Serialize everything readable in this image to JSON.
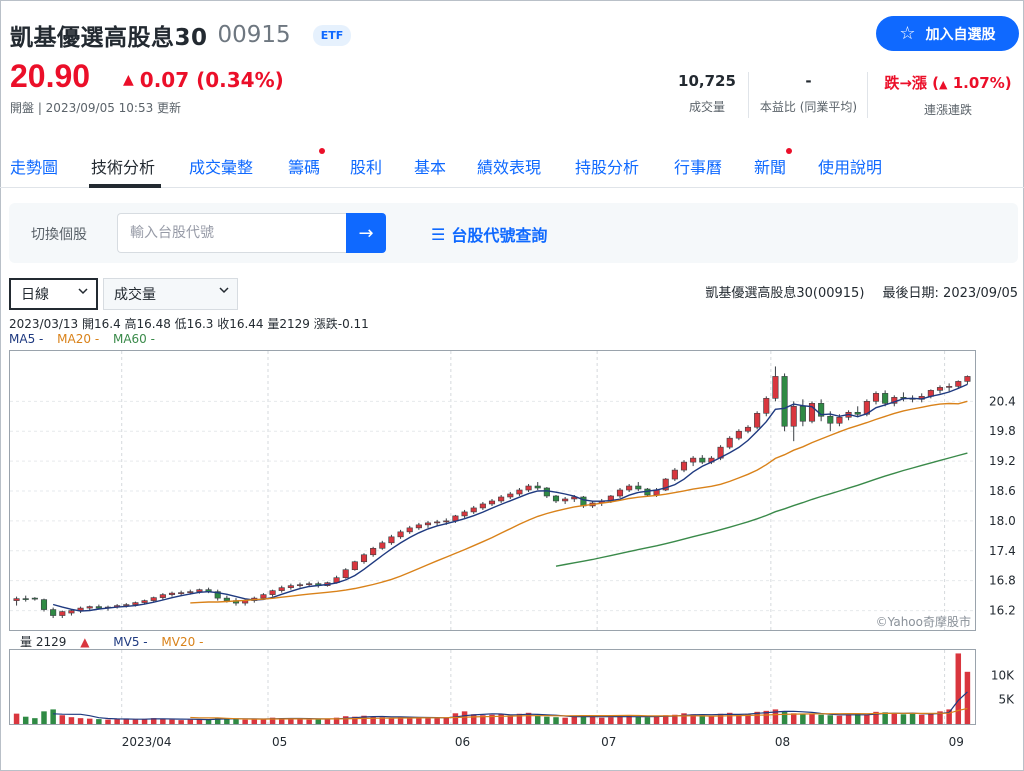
{
  "header": {
    "name": "凱基優選高股息30",
    "code": "00915",
    "badge": "ETF",
    "follow_label": "加入自選股",
    "price": "20.90",
    "change": "0.07 (0.34%)",
    "status": "開盤 | 2023/09/05 10:53 更新",
    "stats": [
      {
        "value": "10,725",
        "label": "成交量"
      },
      {
        "value": "-",
        "label": "本益比 (同業平均)"
      },
      {
        "value_prefix": "跌→漲 (",
        "value_main": "1.07%",
        "value_suffix": ")",
        "label": "連漲連跌"
      }
    ]
  },
  "tabs": [
    "走勢圖",
    "技術分析",
    "成交彙整",
    "籌碼",
    "股利",
    "基本",
    "績效表現",
    "持股分析",
    "行事曆",
    "新聞",
    "使用說明"
  ],
  "active_tab": "技術分析",
  "search": {
    "label": "切換個股",
    "placeholder": "輸入台股代號",
    "lookup_label": "台股代號查詢"
  },
  "controls": {
    "period": "日線",
    "indicator": "成交量",
    "chart_title": "凱基優選高股息30(00915)",
    "last_date": "最後日期: 2023/09/05"
  },
  "ohlc_line": "2023/03/13 開16.4 高16.48 低16.3 收16.44 量2129 漲跌-0.11",
  "ma_legend": [
    {
      "label": "MA5 -",
      "color": "#1f3a80"
    },
    {
      "label": "MA20 -",
      "color": "#d9821a"
    },
    {
      "label": "MA60 -",
      "color": "#3a8a4a"
    }
  ],
  "vol_legend": {
    "vol": "量 2129",
    "arrow": "▲",
    "mv5": "MV5 -",
    "mv20": "MV20 -"
  },
  "watermark": "©Yahoo奇摩股市",
  "colors": {
    "up": "#d9363e",
    "down": "#2f8a44",
    "accent": "#0f69ff",
    "ma5": "#1f3a80",
    "ma20": "#d9821a",
    "ma60": "#3a8a4a"
  },
  "chart_data": {
    "type": "candlestick",
    "price_ticks": [
      16.2,
      16.8,
      17.4,
      18.0,
      18.6,
      19.2,
      19.8,
      20.4
    ],
    "price_range": [
      15.85,
      21.35
    ],
    "volume_ticks": [
      "5K",
      "10K"
    ],
    "volume_range": [
      0,
      15000
    ],
    "x_labels": [
      {
        "label": "2023/04",
        "index": 12
      },
      {
        "label": "05",
        "index": 28
      },
      {
        "label": "06",
        "index": 48
      },
      {
        "label": "07",
        "index": 64
      },
      {
        "label": "08",
        "index": 83
      },
      {
        "label": "09",
        "index": 102
      }
    ],
    "count": 105,
    "candles": [
      [
        16.4,
        16.48,
        16.3,
        16.44
      ],
      [
        16.44,
        16.5,
        16.38,
        16.42
      ],
      [
        16.45,
        16.47,
        16.4,
        16.43
      ],
      [
        16.42,
        16.44,
        16.18,
        16.22
      ],
      [
        16.22,
        16.26,
        16.05,
        16.1
      ],
      [
        16.1,
        16.2,
        16.05,
        16.18
      ],
      [
        16.15,
        16.22,
        16.1,
        16.2
      ],
      [
        16.2,
        16.28,
        16.15,
        16.25
      ],
      [
        16.25,
        16.3,
        16.2,
        16.28
      ],
      [
        16.28,
        16.32,
        16.22,
        16.25
      ],
      [
        16.25,
        16.3,
        16.2,
        16.27
      ],
      [
        16.27,
        16.33,
        16.24,
        16.3
      ],
      [
        16.3,
        16.35,
        16.26,
        16.32
      ],
      [
        16.32,
        16.38,
        16.28,
        16.36
      ],
      [
        16.36,
        16.42,
        16.32,
        16.4
      ],
      [
        16.4,
        16.48,
        16.38,
        16.46
      ],
      [
        16.46,
        16.55,
        16.42,
        16.52
      ],
      [
        16.52,
        16.58,
        16.48,
        16.55
      ],
      [
        16.55,
        16.6,
        16.5,
        16.56
      ],
      [
        16.56,
        16.62,
        16.52,
        16.58
      ],
      [
        16.58,
        16.64,
        16.54,
        16.62
      ],
      [
        16.62,
        16.66,
        16.55,
        16.58
      ],
      [
        16.58,
        16.62,
        16.4,
        16.45
      ],
      [
        16.45,
        16.5,
        16.36,
        16.4
      ],
      [
        16.4,
        16.45,
        16.3,
        16.35
      ],
      [
        16.35,
        16.42,
        16.3,
        16.4
      ],
      [
        16.4,
        16.48,
        16.36,
        16.45
      ],
      [
        16.45,
        16.55,
        16.42,
        16.52
      ],
      [
        16.52,
        16.62,
        16.48,
        16.6
      ],
      [
        16.6,
        16.7,
        16.56,
        16.66
      ],
      [
        16.66,
        16.74,
        16.62,
        16.7
      ],
      [
        16.7,
        16.76,
        16.66,
        16.72
      ],
      [
        16.72,
        16.78,
        16.68,
        16.74
      ],
      [
        16.74,
        16.78,
        16.66,
        16.7
      ],
      [
        16.7,
        16.78,
        16.68,
        16.76
      ],
      [
        16.76,
        16.9,
        16.74,
        16.86
      ],
      [
        16.86,
        17.05,
        16.84,
        17.02
      ],
      [
        17.02,
        17.2,
        17.0,
        17.18
      ],
      [
        17.18,
        17.35,
        17.14,
        17.32
      ],
      [
        17.32,
        17.48,
        17.28,
        17.45
      ],
      [
        17.45,
        17.6,
        17.42,
        17.56
      ],
      [
        17.56,
        17.72,
        17.52,
        17.68
      ],
      [
        17.68,
        17.82,
        17.64,
        17.78
      ],
      [
        17.78,
        17.9,
        17.74,
        17.86
      ],
      [
        17.86,
        17.96,
        17.82,
        17.92
      ],
      [
        17.92,
        18.0,
        17.86,
        17.96
      ],
      [
        17.96,
        18.02,
        17.9,
        17.98
      ],
      [
        17.98,
        18.05,
        17.92,
        18.0
      ],
      [
        18.0,
        18.12,
        17.96,
        18.1
      ],
      [
        18.1,
        18.22,
        18.06,
        18.18
      ],
      [
        18.18,
        18.3,
        18.14,
        18.26
      ],
      [
        18.26,
        18.38,
        18.22,
        18.34
      ],
      [
        18.34,
        18.44,
        18.3,
        18.4
      ],
      [
        18.4,
        18.52,
        18.36,
        18.48
      ],
      [
        18.48,
        18.58,
        18.44,
        18.54
      ],
      [
        18.54,
        18.66,
        18.5,
        18.62
      ],
      [
        18.62,
        18.74,
        18.58,
        18.7
      ],
      [
        18.7,
        18.78,
        18.62,
        18.66
      ],
      [
        18.66,
        18.68,
        18.46,
        18.5
      ],
      [
        18.5,
        18.52,
        18.36,
        18.4
      ],
      [
        18.4,
        18.48,
        18.34,
        18.44
      ],
      [
        18.44,
        18.52,
        18.38,
        18.48
      ],
      [
        18.48,
        18.5,
        18.26,
        18.3
      ],
      [
        18.3,
        18.4,
        18.26,
        18.36
      ],
      [
        18.36,
        18.44,
        18.3,
        18.4
      ],
      [
        18.4,
        18.52,
        18.36,
        18.5
      ],
      [
        18.5,
        18.66,
        18.46,
        18.62
      ],
      [
        18.62,
        18.74,
        18.58,
        18.7
      ],
      [
        18.7,
        18.78,
        18.6,
        18.64
      ],
      [
        18.64,
        18.66,
        18.48,
        18.52
      ],
      [
        18.52,
        18.66,
        18.48,
        18.62
      ],
      [
        18.62,
        18.86,
        18.6,
        18.84
      ],
      [
        18.84,
        19.06,
        18.8,
        19.02
      ],
      [
        19.02,
        19.22,
        18.98,
        19.18
      ],
      [
        19.18,
        19.3,
        19.1,
        19.26
      ],
      [
        19.26,
        19.32,
        19.14,
        19.18
      ],
      [
        19.18,
        19.3,
        19.14,
        19.26
      ],
      [
        19.26,
        19.52,
        19.22,
        19.48
      ],
      [
        19.48,
        19.7,
        19.44,
        19.66
      ],
      [
        19.66,
        19.84,
        19.62,
        19.8
      ],
      [
        19.8,
        19.92,
        19.76,
        19.88
      ],
      [
        19.88,
        20.2,
        19.84,
        20.16
      ],
      [
        20.16,
        20.5,
        20.1,
        20.46
      ],
      [
        20.46,
        21.1,
        20.4,
        20.9
      ],
      [
        20.9,
        20.96,
        19.8,
        19.9
      ],
      [
        19.9,
        20.4,
        19.6,
        20.3
      ],
      [
        20.3,
        20.44,
        19.9,
        20.0
      ],
      [
        20.0,
        20.4,
        19.96,
        20.36
      ],
      [
        20.36,
        20.44,
        20.0,
        20.1
      ],
      [
        20.1,
        20.2,
        19.8,
        19.96
      ],
      [
        19.96,
        20.14,
        19.9,
        20.08
      ],
      [
        20.08,
        20.22,
        20.02,
        20.18
      ],
      [
        20.18,
        20.3,
        20.08,
        20.14
      ],
      [
        20.14,
        20.44,
        20.1,
        20.4
      ],
      [
        20.4,
        20.6,
        20.34,
        20.56
      ],
      [
        20.56,
        20.62,
        20.3,
        20.36
      ],
      [
        20.36,
        20.52,
        20.3,
        20.48
      ],
      [
        20.48,
        20.58,
        20.4,
        20.46
      ],
      [
        20.46,
        20.52,
        20.38,
        20.44
      ],
      [
        20.44,
        20.56,
        20.38,
        20.5
      ],
      [
        20.5,
        20.64,
        20.46,
        20.62
      ],
      [
        20.62,
        20.72,
        20.56,
        20.68
      ],
      [
        20.68,
        20.76,
        20.6,
        20.7
      ],
      [
        20.7,
        20.82,
        20.66,
        20.8
      ],
      [
        20.8,
        20.92,
        20.74,
        20.9
      ]
    ],
    "volumes": [
      2129,
      1500,
      1200,
      2600,
      3000,
      1800,
      1400,
      1200,
      1100,
      1000,
      900,
      1000,
      1100,
      900,
      1000,
      1200,
      1100,
      900,
      800,
      900,
      1000,
      900,
      1300,
      1100,
      1000,
      900,
      1000,
      1100,
      1300,
      1200,
      1100,
      1000,
      900,
      1000,
      1100,
      1300,
      1600,
      1500,
      1700,
      1500,
      1400,
      1300,
      1500,
      1400,
      1300,
      1200,
      1200,
      1300,
      2200,
      2600,
      2000,
      1800,
      1900,
      2000,
      1800,
      2100,
      2300,
      1700,
      1500,
      1400,
      1300,
      1600,
      1800,
      1500,
      1300,
      1400,
      1600,
      1700,
      1500,
      1400,
      1500,
      1800,
      1900,
      2200,
      2000,
      1800,
      1700,
      2100,
      2300,
      2000,
      2100,
      2500,
      2700,
      3000,
      2600,
      2200,
      2000,
      2100,
      1900,
      1800,
      1700,
      2000,
      2100,
      1900,
      2500,
      2400,
      2200,
      2000,
      2100,
      1900,
      2200,
      2600,
      3000,
      14500,
      10725
    ]
  }
}
